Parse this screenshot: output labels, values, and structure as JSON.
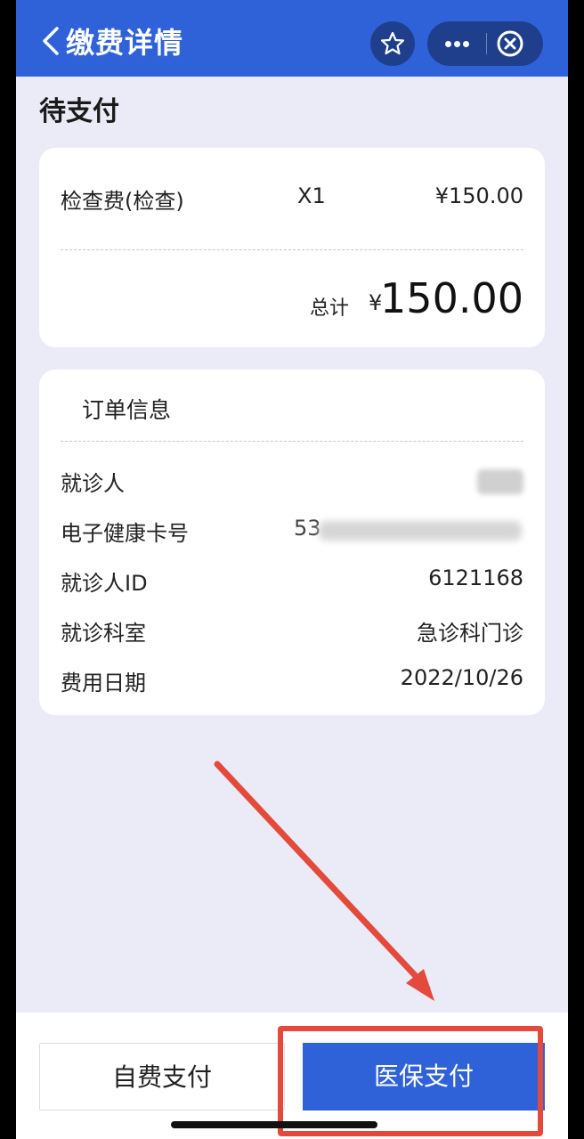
{
  "nav": {
    "title": "缴费详情"
  },
  "status": "待支付",
  "fee": {
    "item_name": "检查费(检查)",
    "quantity": "X1",
    "price": "¥150.00",
    "total_label": "总计",
    "total_currency": "¥",
    "total_value": "150.00"
  },
  "order": {
    "title": "订单信息",
    "rows": [
      {
        "label": "就诊人",
        "value": ""
      },
      {
        "label": "电子健康卡号",
        "value": "53"
      },
      {
        "label": "就诊人ID",
        "value": "6121168"
      },
      {
        "label": "就诊科室",
        "value": "急诊科门诊"
      },
      {
        "label": "费用日期",
        "value": "2022/10/26"
      }
    ]
  },
  "actions": {
    "self_pay": "自费支付",
    "insurance_pay": "医保支付"
  },
  "colors": {
    "primary": "#2f62d9",
    "annotation": "#e34a3c"
  },
  "icons": {
    "back": "chevron-left-icon",
    "favorite": "star-icon",
    "more": "more-dots-icon",
    "close": "close-circle-icon"
  }
}
